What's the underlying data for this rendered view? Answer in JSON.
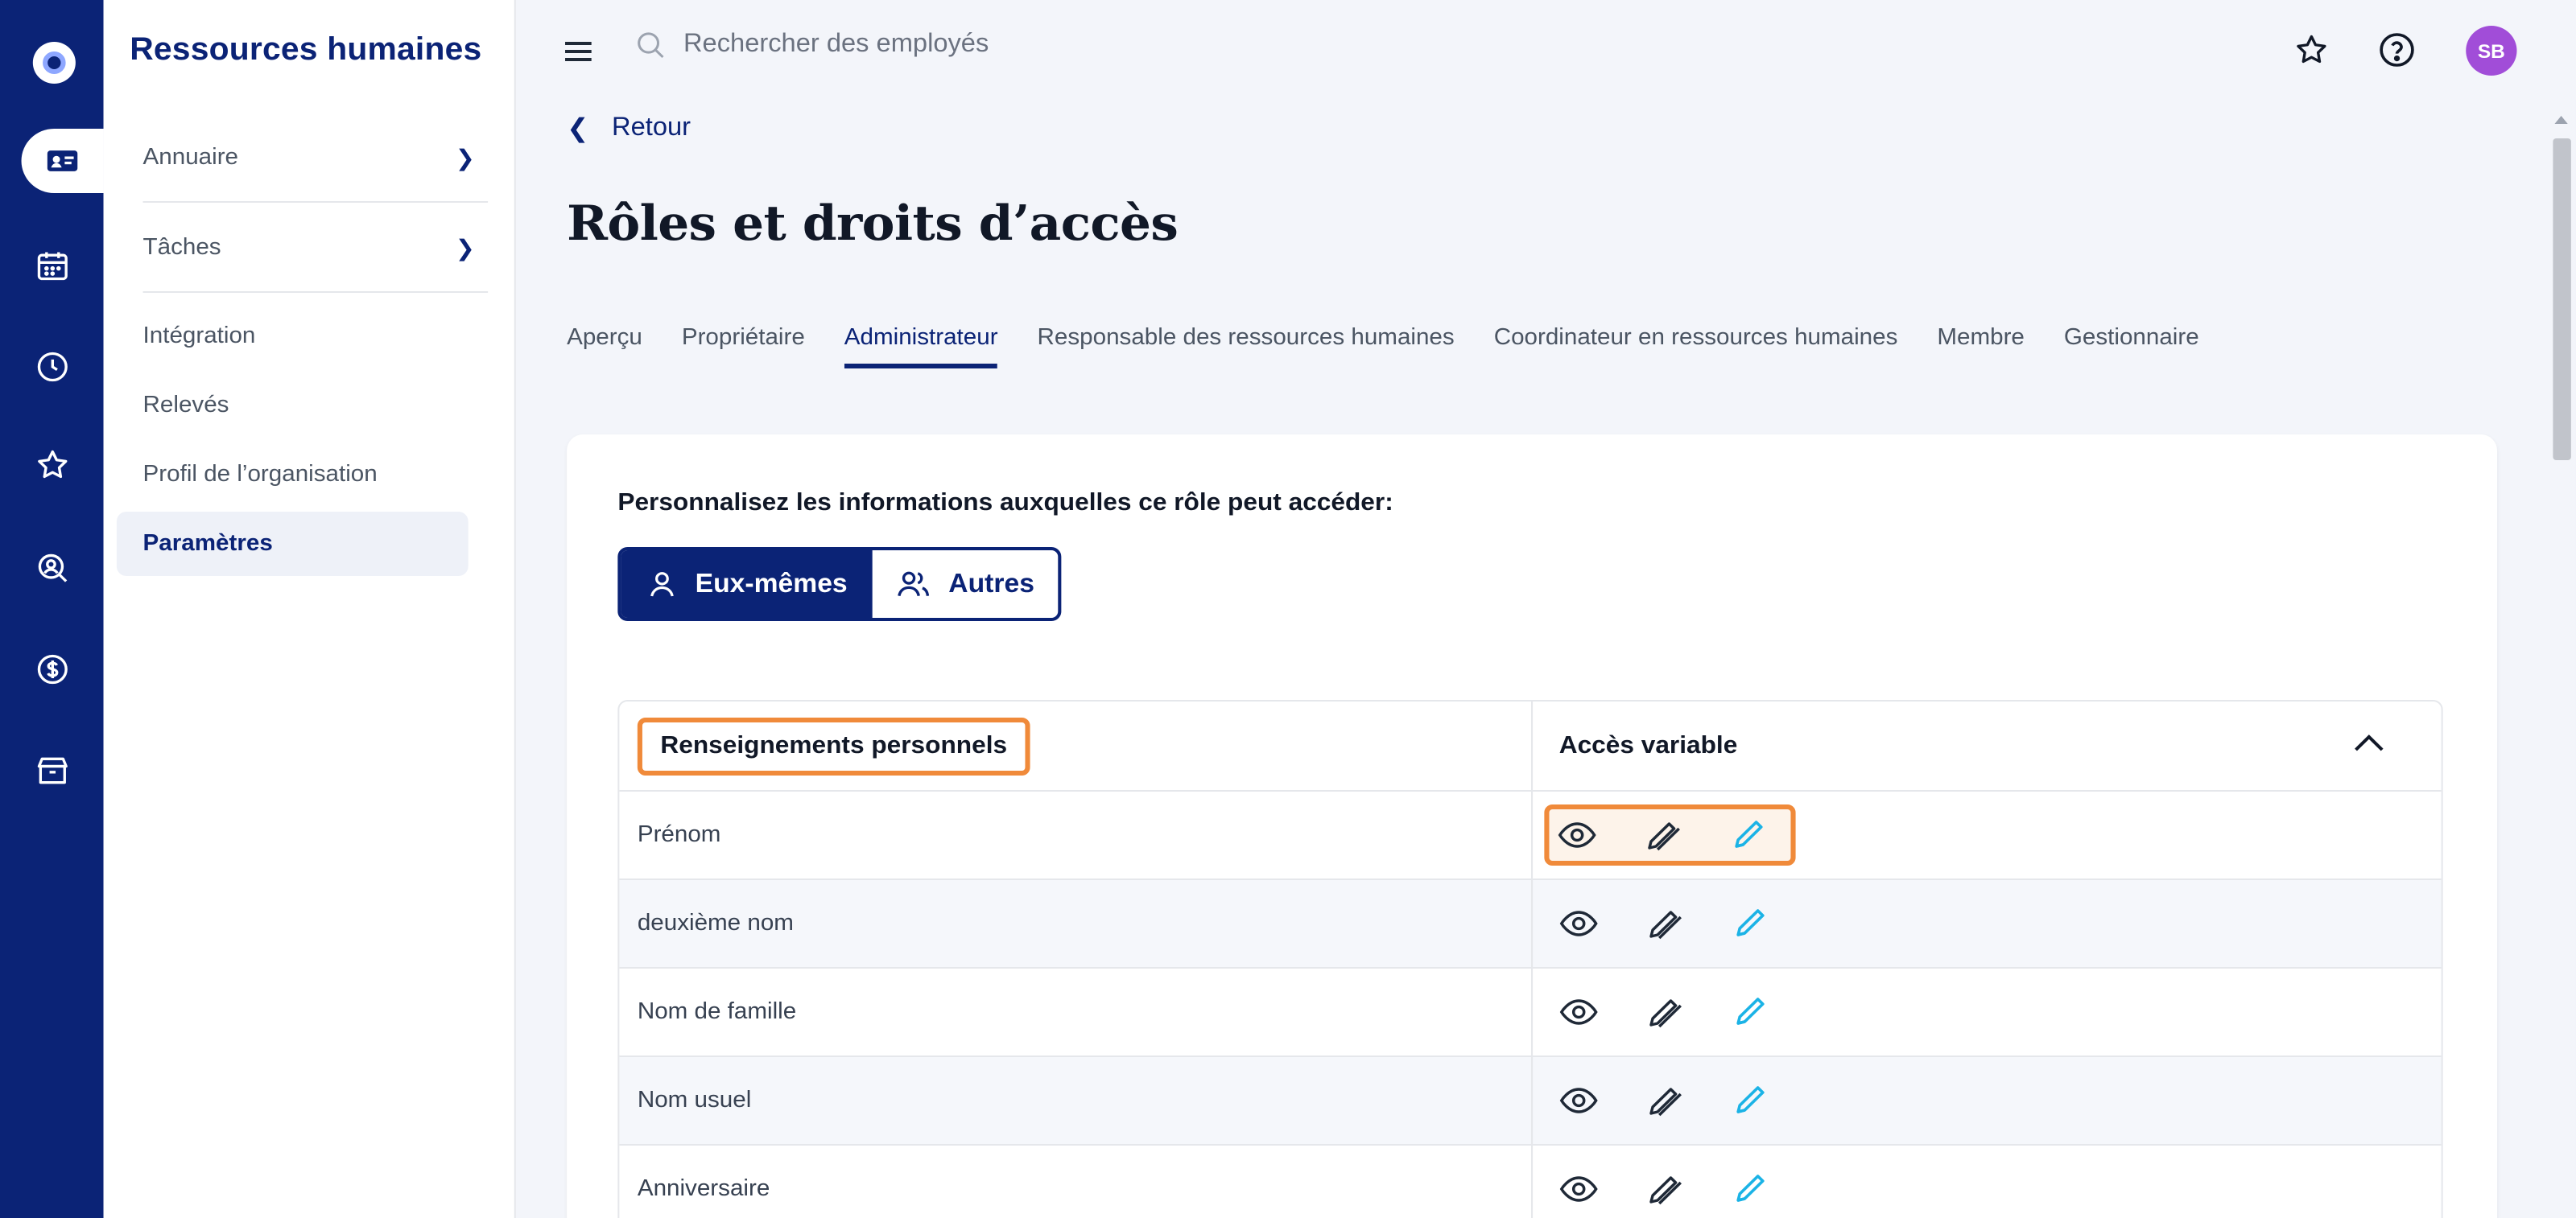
{
  "app": {
    "title": "Ressources humaines"
  },
  "sidebar": {
    "items": [
      {
        "label": "Annuaire",
        "has_children": true
      },
      {
        "label": "Tâches",
        "has_children": true
      },
      {
        "label": "Intégration"
      },
      {
        "label": "Relevés"
      },
      {
        "label": "Profil de l’organisation"
      },
      {
        "label": "Paramètres",
        "active": true
      }
    ]
  },
  "rail": {
    "icons": [
      "logo-icon",
      "people-card-icon",
      "calendar-icon",
      "clock-icon",
      "star-icon",
      "search-person-icon",
      "dollar-icon",
      "box-icon"
    ],
    "active_index": 1
  },
  "header": {
    "search_placeholder": "Rechercher des employés",
    "avatar_initials": "SB"
  },
  "page": {
    "back_label": "Retour",
    "title": "Rôles et droits d’accès",
    "tabs": [
      "Aperçu",
      "Propriétaire",
      "Administrateur",
      "Responsable des ressources humaines",
      "Coordinateur en ressources humaines",
      "Membre",
      "Gestionnaire"
    ],
    "active_tab": 2
  },
  "card": {
    "prompt": "Personnalisez les informations auxquelles ce rôle peut accéder:",
    "toggle": {
      "self": "Eux-mêmes",
      "others": "Autres",
      "selected": "self"
    },
    "table": {
      "col1_header": "Renseignements personnels",
      "col2_header": "Accès variable",
      "rows": [
        "Prénom",
        "deuxième nom",
        "Nom de famille",
        "Nom usuel",
        "Anniversaire"
      ]
    }
  },
  "colors": {
    "brand": "#0b2376",
    "highlight": "#f08a3a",
    "edit_accent": "#1bb3e6",
    "avatar": "#a14dd8"
  }
}
